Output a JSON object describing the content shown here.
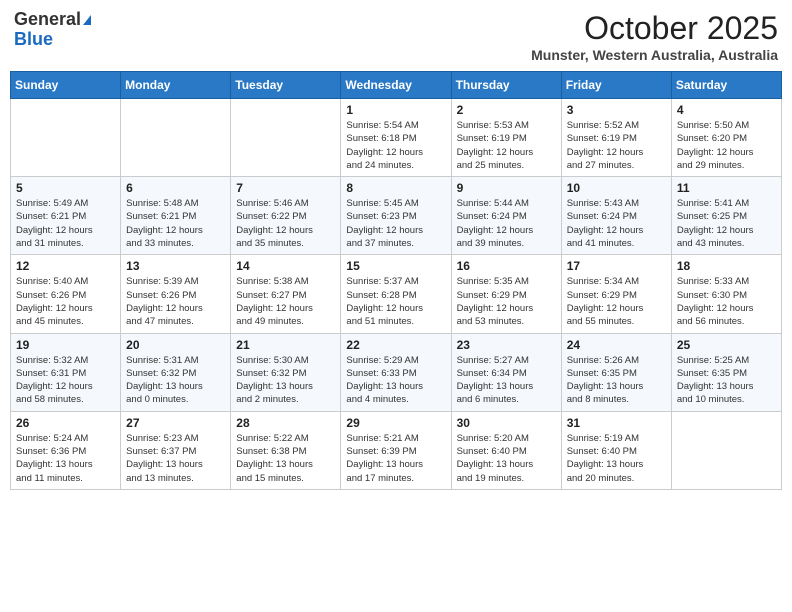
{
  "header": {
    "logo_line1": "General",
    "logo_line2": "Blue",
    "main_title": "October 2025",
    "subtitle": "Munster, Western Australia, Australia"
  },
  "calendar": {
    "days_of_week": [
      "Sunday",
      "Monday",
      "Tuesday",
      "Wednesday",
      "Thursday",
      "Friday",
      "Saturday"
    ],
    "weeks": [
      [
        {
          "day": "",
          "info": ""
        },
        {
          "day": "",
          "info": ""
        },
        {
          "day": "",
          "info": ""
        },
        {
          "day": "1",
          "info": "Sunrise: 5:54 AM\nSunset: 6:18 PM\nDaylight: 12 hours\nand 24 minutes."
        },
        {
          "day": "2",
          "info": "Sunrise: 5:53 AM\nSunset: 6:19 PM\nDaylight: 12 hours\nand 25 minutes."
        },
        {
          "day": "3",
          "info": "Sunrise: 5:52 AM\nSunset: 6:19 PM\nDaylight: 12 hours\nand 27 minutes."
        },
        {
          "day": "4",
          "info": "Sunrise: 5:50 AM\nSunset: 6:20 PM\nDaylight: 12 hours\nand 29 minutes."
        }
      ],
      [
        {
          "day": "5",
          "info": "Sunrise: 5:49 AM\nSunset: 6:21 PM\nDaylight: 12 hours\nand 31 minutes."
        },
        {
          "day": "6",
          "info": "Sunrise: 5:48 AM\nSunset: 6:21 PM\nDaylight: 12 hours\nand 33 minutes."
        },
        {
          "day": "7",
          "info": "Sunrise: 5:46 AM\nSunset: 6:22 PM\nDaylight: 12 hours\nand 35 minutes."
        },
        {
          "day": "8",
          "info": "Sunrise: 5:45 AM\nSunset: 6:23 PM\nDaylight: 12 hours\nand 37 minutes."
        },
        {
          "day": "9",
          "info": "Sunrise: 5:44 AM\nSunset: 6:24 PM\nDaylight: 12 hours\nand 39 minutes."
        },
        {
          "day": "10",
          "info": "Sunrise: 5:43 AM\nSunset: 6:24 PM\nDaylight: 12 hours\nand 41 minutes."
        },
        {
          "day": "11",
          "info": "Sunrise: 5:41 AM\nSunset: 6:25 PM\nDaylight: 12 hours\nand 43 minutes."
        }
      ],
      [
        {
          "day": "12",
          "info": "Sunrise: 5:40 AM\nSunset: 6:26 PM\nDaylight: 12 hours\nand 45 minutes."
        },
        {
          "day": "13",
          "info": "Sunrise: 5:39 AM\nSunset: 6:26 PM\nDaylight: 12 hours\nand 47 minutes."
        },
        {
          "day": "14",
          "info": "Sunrise: 5:38 AM\nSunset: 6:27 PM\nDaylight: 12 hours\nand 49 minutes."
        },
        {
          "day": "15",
          "info": "Sunrise: 5:37 AM\nSunset: 6:28 PM\nDaylight: 12 hours\nand 51 minutes."
        },
        {
          "day": "16",
          "info": "Sunrise: 5:35 AM\nSunset: 6:29 PM\nDaylight: 12 hours\nand 53 minutes."
        },
        {
          "day": "17",
          "info": "Sunrise: 5:34 AM\nSunset: 6:29 PM\nDaylight: 12 hours\nand 55 minutes."
        },
        {
          "day": "18",
          "info": "Sunrise: 5:33 AM\nSunset: 6:30 PM\nDaylight: 12 hours\nand 56 minutes."
        }
      ],
      [
        {
          "day": "19",
          "info": "Sunrise: 5:32 AM\nSunset: 6:31 PM\nDaylight: 12 hours\nand 58 minutes."
        },
        {
          "day": "20",
          "info": "Sunrise: 5:31 AM\nSunset: 6:32 PM\nDaylight: 13 hours\nand 0 minutes."
        },
        {
          "day": "21",
          "info": "Sunrise: 5:30 AM\nSunset: 6:32 PM\nDaylight: 13 hours\nand 2 minutes."
        },
        {
          "day": "22",
          "info": "Sunrise: 5:29 AM\nSunset: 6:33 PM\nDaylight: 13 hours\nand 4 minutes."
        },
        {
          "day": "23",
          "info": "Sunrise: 5:27 AM\nSunset: 6:34 PM\nDaylight: 13 hours\nand 6 minutes."
        },
        {
          "day": "24",
          "info": "Sunrise: 5:26 AM\nSunset: 6:35 PM\nDaylight: 13 hours\nand 8 minutes."
        },
        {
          "day": "25",
          "info": "Sunrise: 5:25 AM\nSunset: 6:35 PM\nDaylight: 13 hours\nand 10 minutes."
        }
      ],
      [
        {
          "day": "26",
          "info": "Sunrise: 5:24 AM\nSunset: 6:36 PM\nDaylight: 13 hours\nand 11 minutes."
        },
        {
          "day": "27",
          "info": "Sunrise: 5:23 AM\nSunset: 6:37 PM\nDaylight: 13 hours\nand 13 minutes."
        },
        {
          "day": "28",
          "info": "Sunrise: 5:22 AM\nSunset: 6:38 PM\nDaylight: 13 hours\nand 15 minutes."
        },
        {
          "day": "29",
          "info": "Sunrise: 5:21 AM\nSunset: 6:39 PM\nDaylight: 13 hours\nand 17 minutes."
        },
        {
          "day": "30",
          "info": "Sunrise: 5:20 AM\nSunset: 6:40 PM\nDaylight: 13 hours\nand 19 minutes."
        },
        {
          "day": "31",
          "info": "Sunrise: 5:19 AM\nSunset: 6:40 PM\nDaylight: 13 hours\nand 20 minutes."
        },
        {
          "day": "",
          "info": ""
        }
      ]
    ]
  }
}
